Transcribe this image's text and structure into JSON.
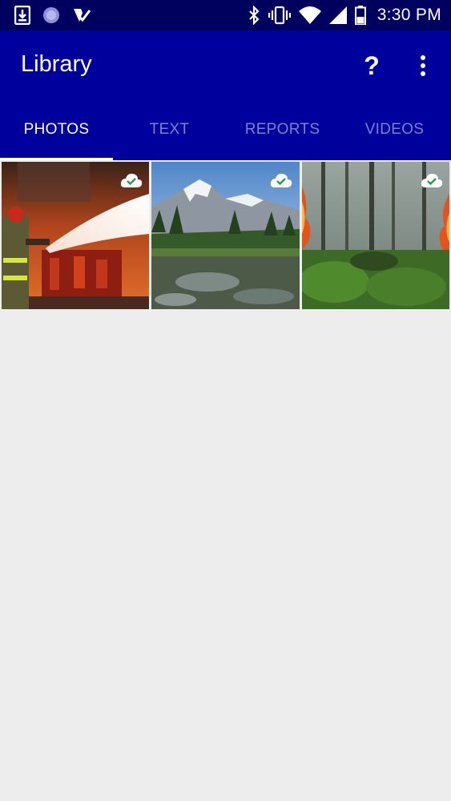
{
  "status_bar": {
    "time": "3:30 PM",
    "icons": [
      "download-icon",
      "circle-app-icon",
      "check-app-icon",
      "bluetooth-icon",
      "vibrate-icon",
      "wifi-icon",
      "signal-icon",
      "battery-icon"
    ]
  },
  "app_bar": {
    "title": "Library",
    "help_label": "?",
    "icons": [
      "help-icon",
      "more-vert-icon"
    ]
  },
  "tabs": [
    {
      "label": "PHOTOS",
      "active": true
    },
    {
      "label": "TEXT",
      "active": false
    },
    {
      "label": "REPORTS",
      "active": false
    },
    {
      "label": "VIDEOS",
      "active": false
    }
  ],
  "photos": [
    {
      "subject": "firefighter spraying water at burning building",
      "synced": true
    },
    {
      "subject": "snowy mountain peak above forest and stream",
      "synced": true
    },
    {
      "subject": "forest fire among trees",
      "synced": true
    }
  ],
  "colors": {
    "status_bar": "#00005f",
    "app_bar": "#00009c",
    "tab_inactive": "#7d7fd0",
    "background": "#ededed",
    "sync_check": "#1e9e4a"
  }
}
